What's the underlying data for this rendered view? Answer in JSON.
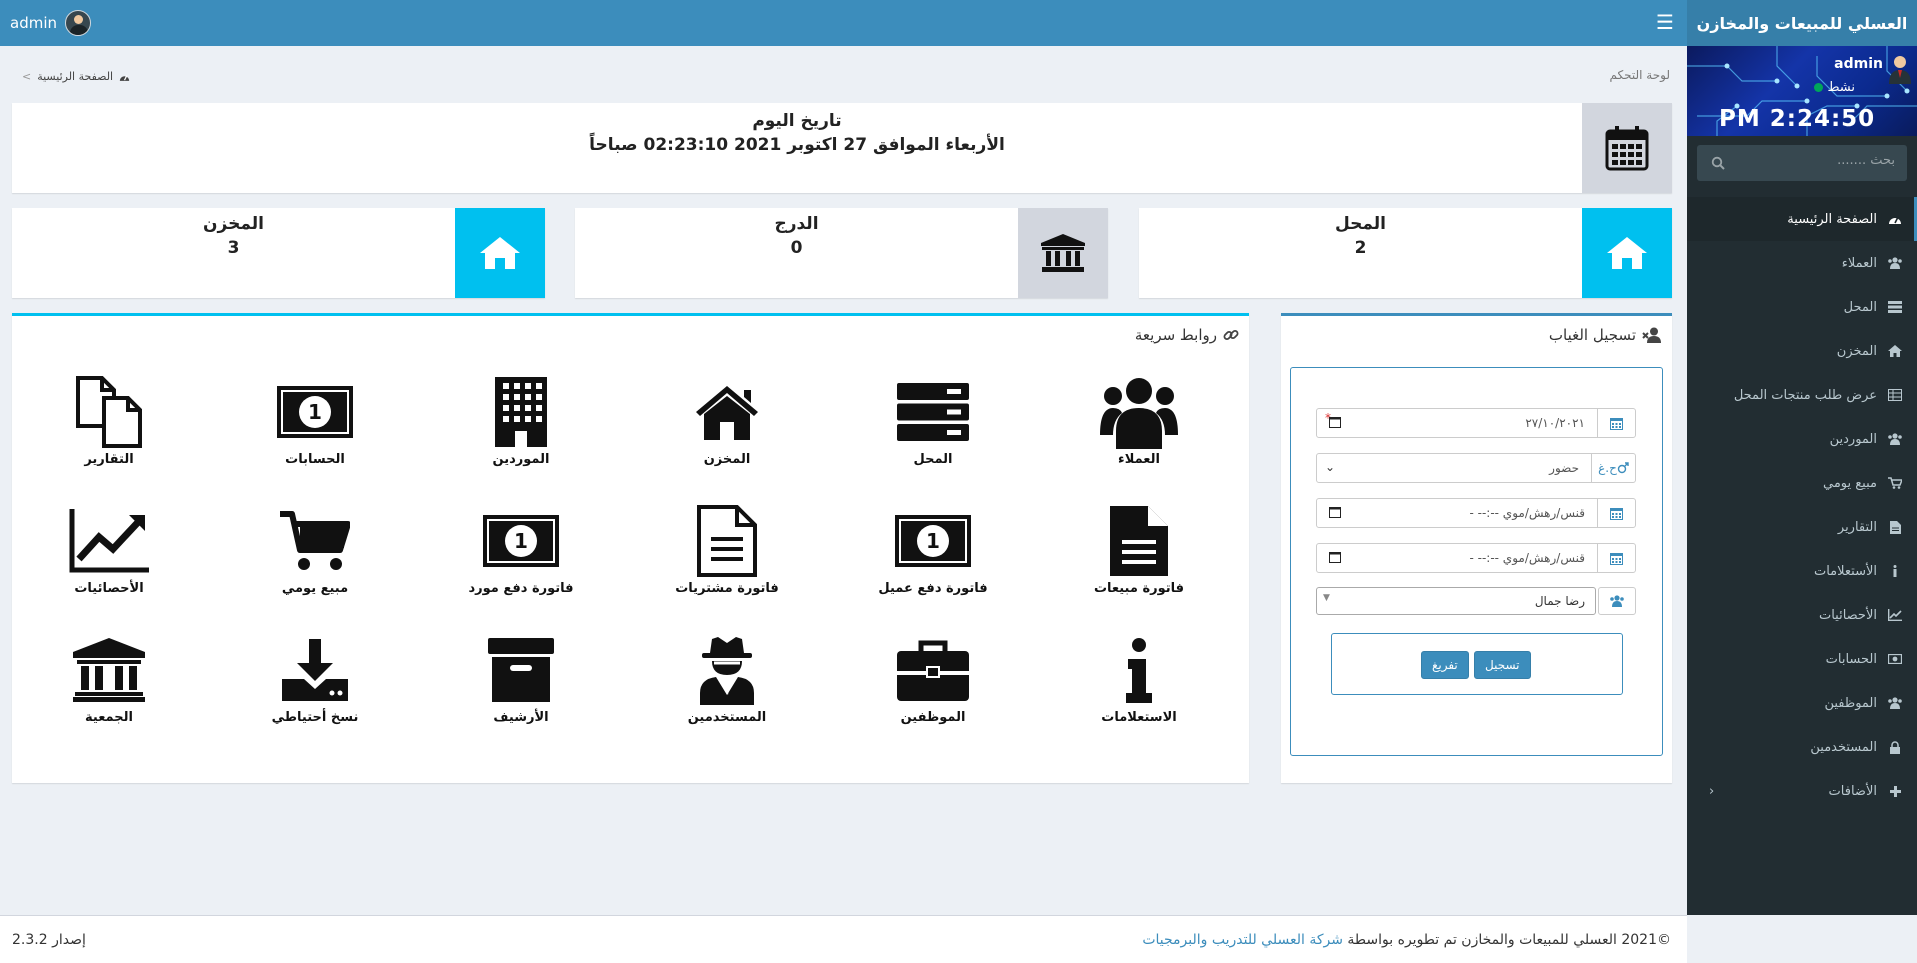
{
  "app": {
    "brand_title": "العسلي للمبيعات والمخازن",
    "top_username": "admin"
  },
  "user_panel": {
    "name": "admin",
    "status": "نشط",
    "clock": "PM 2:24:50"
  },
  "search": {
    "placeholder": "بحث ......."
  },
  "menu": {
    "items": [
      {
        "label": "الصفحة الرئيسية",
        "icon": "dashboard-icon",
        "active": true
      },
      {
        "label": "العملاء",
        "icon": "users-icon"
      },
      {
        "label": "المحل",
        "icon": "server-icon"
      },
      {
        "label": "المخزن",
        "icon": "home-icon"
      },
      {
        "label": "عرض طلب منتجات المحل",
        "icon": "table-icon"
      },
      {
        "label": "الموردين",
        "icon": "users-icon"
      },
      {
        "label": "مبيع يومي",
        "icon": "cart-icon"
      },
      {
        "label": "التقارير",
        "icon": "file-icon"
      },
      {
        "label": "الأستعلامات",
        "icon": "info-icon"
      },
      {
        "label": "الأحصائيات",
        "icon": "chart-icon"
      },
      {
        "label": "الحسابات",
        "icon": "money-icon"
      },
      {
        "label": "الموظفين",
        "icon": "users-icon"
      },
      {
        "label": "المستخدمين",
        "icon": "lock-icon"
      },
      {
        "label": "الأضافات",
        "icon": "plus-icon"
      }
    ]
  },
  "header": {
    "page_title": "لوحة التحكم",
    "breadcrumb_home": "الصفحة الرئيسية"
  },
  "date_box": {
    "title": "تاريخ اليوم",
    "value": "الأربعاء الموافق 27 اكتوبر 2021 02:23:10 صباحاً"
  },
  "info_boxes": [
    {
      "label": "المحل",
      "value": "2",
      "color": "#00c0ef",
      "icon": "home-icon"
    },
    {
      "label": "الدرج",
      "value": "0",
      "color": "#d2d6de",
      "icon": "bank-icon"
    },
    {
      "label": "المخزن",
      "value": "3",
      "color": "#00c0ef",
      "icon": "home-icon"
    }
  ],
  "absence": {
    "title": "تسجيل الغياب",
    "date_value": "٢٧/١٠/٢٠٢١",
    "type_prefix": "ح.غ",
    "type_value": "حضور",
    "time_placeholder": "قنس/رهش/موي --:-- -",
    "employee": "رضا جمال",
    "save_button": "تسجيل",
    "clear_button": "تفريغ"
  },
  "quick_links": {
    "title": "روابط سريعة",
    "items": [
      {
        "label": "العملاء",
        "icon": "users-icon"
      },
      {
        "label": "المحل",
        "icon": "server-icon"
      },
      {
        "label": "المخزن",
        "icon": "home-icon"
      },
      {
        "label": "الموردين",
        "icon": "building-icon"
      },
      {
        "label": "الحسابات",
        "icon": "money-icon"
      },
      {
        "label": "التقارير",
        "icon": "copy-icon"
      },
      {
        "label": "فاتورة مبيعات",
        "icon": "file-icon"
      },
      {
        "label": "فاتورة دفع عميل",
        "icon": "money-icon"
      },
      {
        "label": "فاتورة مشتريات",
        "icon": "file-text-icon"
      },
      {
        "label": "فاتورة دفع مورد",
        "icon": "money-icon"
      },
      {
        "label": "مبيع يومي",
        "icon": "cart-icon"
      },
      {
        "label": "الأحصائيات",
        "icon": "line-chart-icon"
      },
      {
        "label": "الاستعلامات",
        "icon": "info-icon"
      },
      {
        "label": "الموظفين",
        "icon": "briefcase-icon"
      },
      {
        "label": "المستخدمين",
        "icon": "user-secret-icon"
      },
      {
        "label": "الأرشيف",
        "icon": "archive-icon"
      },
      {
        "label": "نسخ أحتياطي",
        "icon": "download-icon"
      },
      {
        "label": "الجمعية",
        "icon": "bank-icon"
      }
    ]
  },
  "footer": {
    "copyright": "©2021 العسلي للمبيعات والمخازن تم تطويره بواسطة",
    "company_link": "شركة العسلي للتدريب والبرمجيات",
    "version_label": "إصدار",
    "version": "2.3.2"
  }
}
